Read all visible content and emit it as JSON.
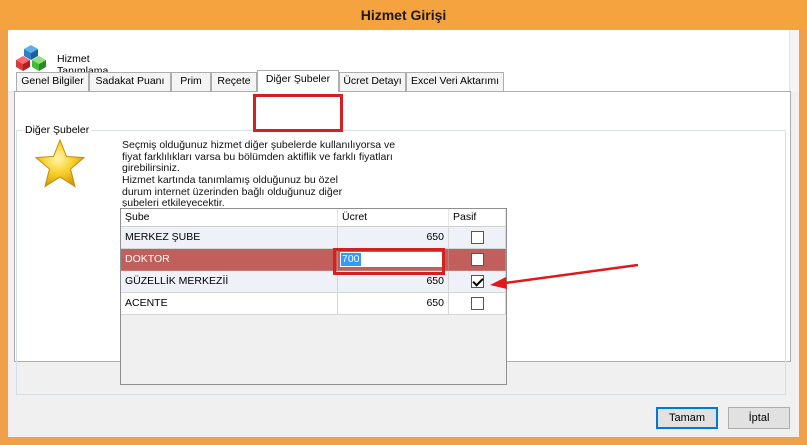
{
  "window": {
    "title": "Hizmet Girişi"
  },
  "header": {
    "title": "Hizmet Tanımlama",
    "icon": "cubes-icon"
  },
  "tabs": [
    {
      "label": "Genel Bilgiler"
    },
    {
      "label": "Sadakat Puanı"
    },
    {
      "label": "Prim"
    },
    {
      "label": "Reçete"
    },
    {
      "label": "Diğer Şubeler",
      "active": true
    },
    {
      "label": "Ücret Detayı"
    },
    {
      "label": "Excel Veri Aktarımı"
    }
  ],
  "group": {
    "legend": "Diğer Şubeler",
    "icon": "star-icon",
    "description1": "Seçmiş olduğunuz hizmet diğer şubelerde kullanılıyorsa ve fiyat farklılıkları varsa bu bölümden aktiflik ve farklı fiyatları girebilirsiniz.",
    "description2": "Hizmet kartında tanımlamış olduğunuz bu özel durum internet üzerinden bağlı olduğunuz diğer şubeleri etkileyecektir."
  },
  "grid": {
    "columns": [
      "Şube",
      "Ücret",
      "Pasif"
    ],
    "rows": [
      {
        "sube": "MERKEZ ŞUBE",
        "ucret": "650",
        "pasif": false
      },
      {
        "sube": "DOKTOR",
        "ucret": "700",
        "pasif": false,
        "selected": true,
        "editing": true
      },
      {
        "sube": "GÜZELLİK MERKEZİİ",
        "ucret": "650",
        "pasif": true
      },
      {
        "sube": "ACENTE",
        "ucret": "650",
        "pasif": false
      }
    ]
  },
  "buttons": {
    "ok": "Tamam",
    "cancel": "İptal"
  },
  "colors": {
    "titlebar": "#f4a33f",
    "selectedRow": "#c15f5c",
    "highlight": "#d42020"
  }
}
